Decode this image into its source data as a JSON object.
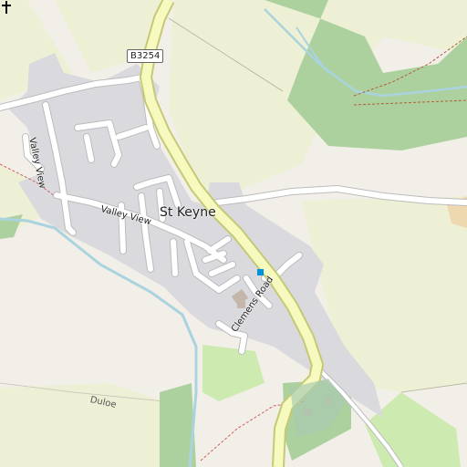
{
  "map": {
    "place_name": "St Keyne",
    "road_ref": "B3254",
    "streets": [
      "Valley View",
      "Valley View",
      "Clemens Road"
    ],
    "localities": [
      "Duloe"
    ],
    "icons": [
      "church-icon",
      "bus-stop-icon"
    ],
    "colors": {
      "background": "#f2efe9",
      "residential": "#d9d9de",
      "farmland": "#eef0d5",
      "wood": "#add19e",
      "grass": "#cdebb0",
      "water": "#aad3df",
      "secondary_road_fill": "#f7fabf",
      "secondary_road_casing": "#c5c976",
      "minor_road": "#ffffff"
    }
  }
}
